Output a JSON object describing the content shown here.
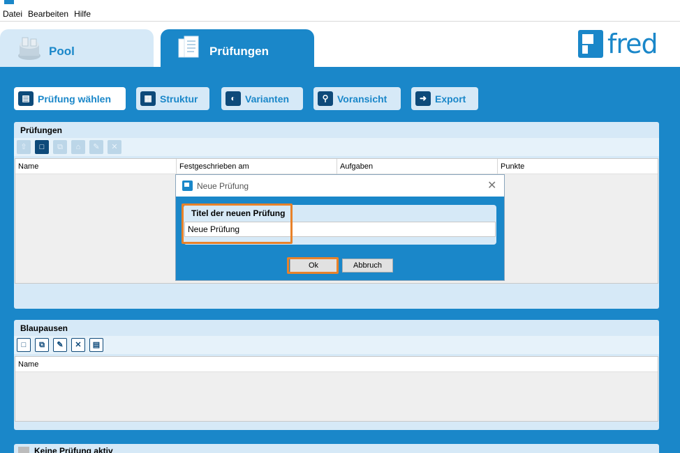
{
  "menu": [
    "Datei",
    "Bearbeiten",
    "Hilfe"
  ],
  "tabs": [
    {
      "label": "Pool",
      "active": false
    },
    {
      "label": "Prüfungen",
      "active": true
    }
  ],
  "logo": {
    "text": "fred"
  },
  "nav_buttons": [
    {
      "label": "Prüfung wählen",
      "icon": "document-list-icon",
      "active": true
    },
    {
      "label": "Struktur",
      "icon": "structure-icon",
      "active": false
    },
    {
      "label": "Varianten",
      "icon": "variants-icon",
      "active": false
    },
    {
      "label": "Voransicht",
      "icon": "preview-icon",
      "active": false
    },
    {
      "label": "Export",
      "icon": "export-arrow-icon",
      "active": false
    }
  ],
  "pruefungen_panel": {
    "title": "Prüfungen",
    "columns": [
      "Name",
      "Festgeschrieben am",
      "Aufgaben",
      "Punkte"
    ]
  },
  "blaupausen_panel": {
    "title": "Blaupausen",
    "columns": [
      "Name"
    ]
  },
  "status": {
    "text": "Keine Prüfung aktiv"
  },
  "dialog": {
    "title": "Neue Prüfung",
    "field_label": "Titel der neuen Prüfung",
    "field_value": "Neue Prüfung",
    "ok_label": "Ok",
    "cancel_label": "Abbruch"
  },
  "colors": {
    "accent": "#1a87c9",
    "panel": "#d6e9f7",
    "highlight": "#e8822a",
    "dark_icon": "#0e4a7a"
  }
}
